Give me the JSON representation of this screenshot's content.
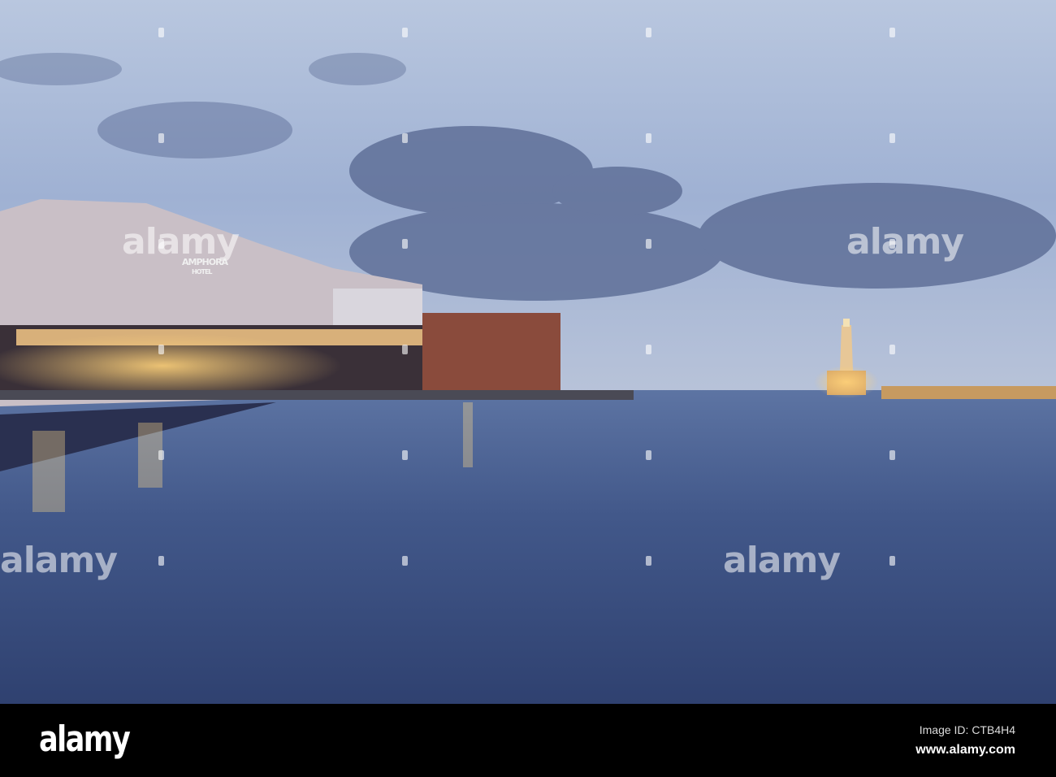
{
  "photo": {
    "watermark": "alamy",
    "signs": [
      "AMPHORA",
      "HOTEL"
    ]
  },
  "footer": {
    "logo": "alamy",
    "image_id": "Image ID: CTB4H4",
    "url": "www.alamy.com"
  },
  "colors": {
    "sky_top": "#aebfdc",
    "cloud": "#5f6f98",
    "water": "#3f5582",
    "footer": "#000000"
  }
}
